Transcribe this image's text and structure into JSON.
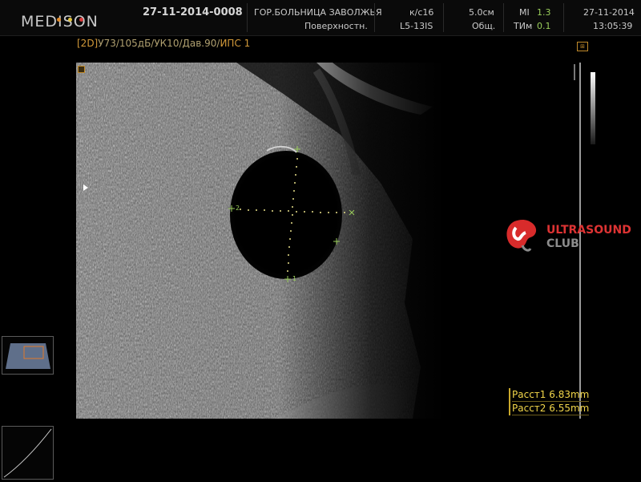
{
  "header": {
    "brand": "MEDISON",
    "brand_dot_colors": [
      "#e08a2a",
      "#e0c23a",
      "#d93a3a"
    ],
    "exam_id": "27-11-2014-0008",
    "hospital": "ГОР.БОЛЬНИЦА ЗАВОЛЖЬЯ",
    "preset": "Поверхностн.",
    "frame_rate": "к/с16",
    "probe": "L5-13IS",
    "depth": "5.0см",
    "app": "Общ.",
    "mi_label": "MI",
    "mi_value": "1.3",
    "tim_label": "ТИм",
    "tim_value": "0.1",
    "date": "27-11-2014",
    "time": "13:05:39"
  },
  "params": {
    "mode": "[2D]",
    "settings": "У73/105дБ/УК10/Дав.90/",
    "ips": "ИПС 1"
  },
  "orientation_icon": "orientation-marker",
  "caliper_labels": {
    "c1": "1",
    "c2": "2"
  },
  "watermark": {
    "line1": "ULTRASOUND",
    "line2": "CLUB",
    "color": "#d82b2b"
  },
  "measurements": [
    {
      "label": "Расст1",
      "value": "6.83mm"
    },
    {
      "label": "Расст2",
      "value": "6.55mm"
    }
  ]
}
